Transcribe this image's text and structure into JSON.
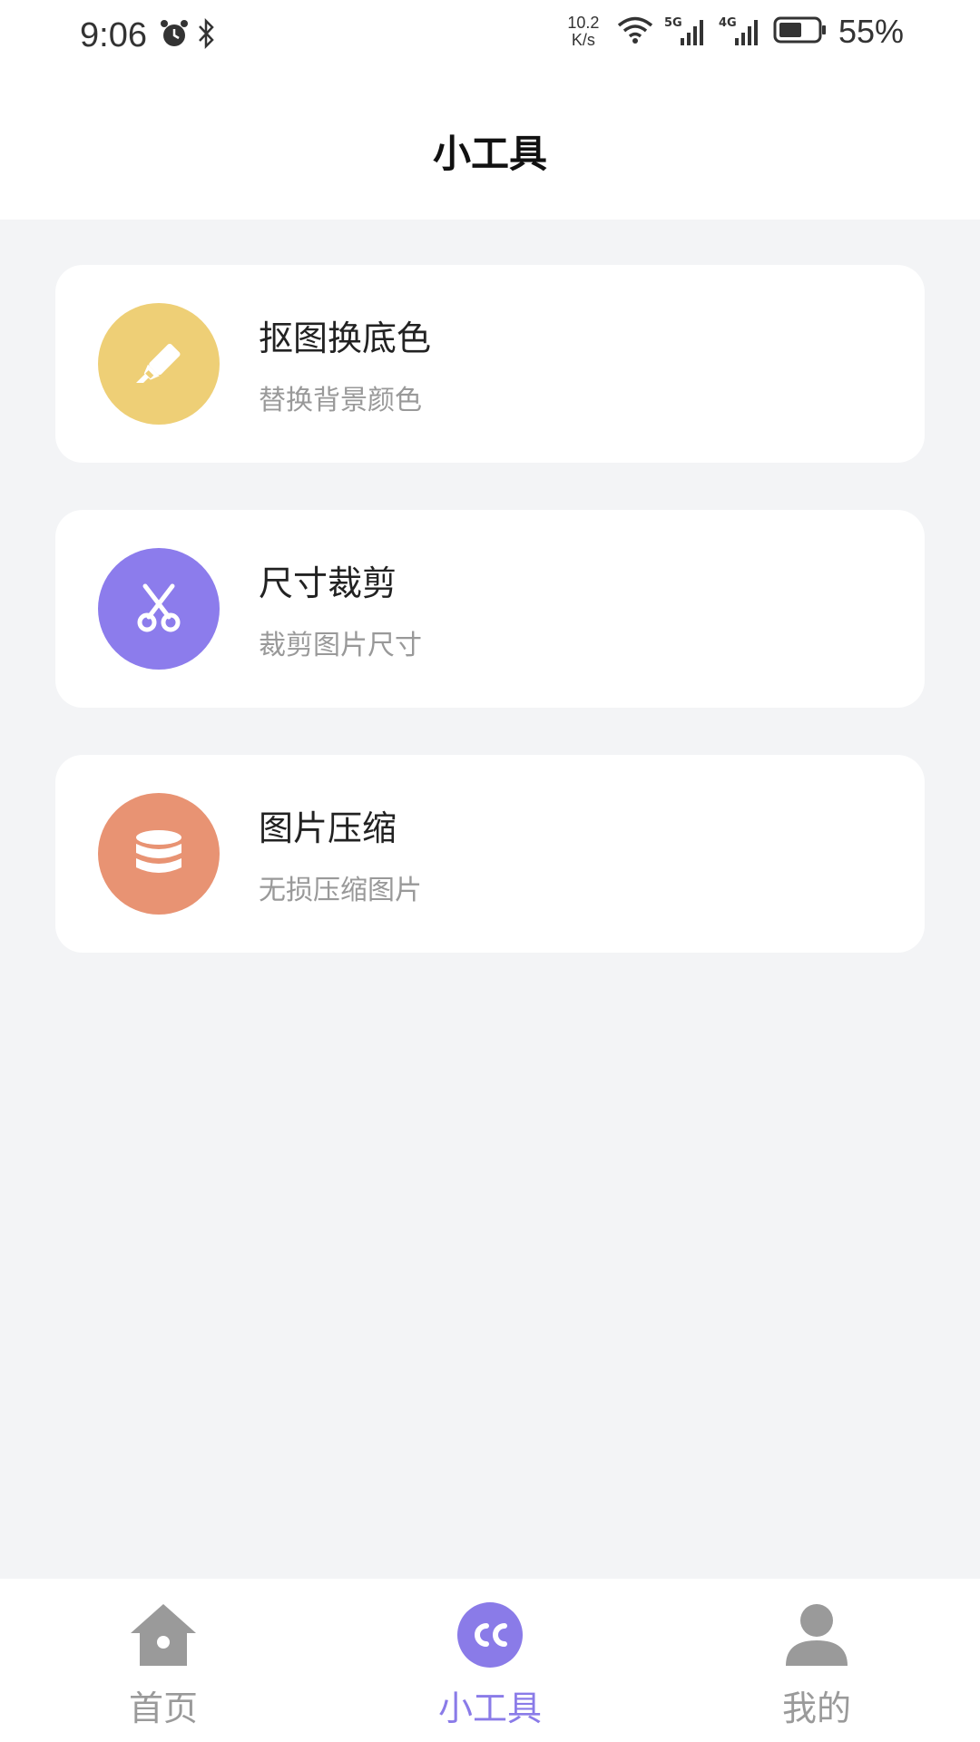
{
  "status_bar": {
    "time": "9:06",
    "net_speed_value": "10.2",
    "net_speed_unit": "K/s",
    "signal_1_label": "5G",
    "signal_2_label": "4G",
    "battery": "55%",
    "icons": [
      "alarm-icon",
      "bluetooth-icon",
      "wifi-icon",
      "signal-5g-icon",
      "signal-4g-icon",
      "battery-icon"
    ]
  },
  "header": {
    "title": "小工具"
  },
  "tools": [
    {
      "title": "抠图换底色",
      "subtitle": "替换背景颜色",
      "icon": "highlighter-icon",
      "color": "#eecf76"
    },
    {
      "title": "尺寸裁剪",
      "subtitle": "裁剪图片尺寸",
      "icon": "scissors-icon",
      "color": "#8c7cec"
    },
    {
      "title": "图片压缩",
      "subtitle": "无损压缩图片",
      "icon": "database-icon",
      "color": "#e89373"
    }
  ],
  "tabbar": {
    "tabs": [
      {
        "label": "首页",
        "icon": "home-icon",
        "active": false
      },
      {
        "label": "小工具",
        "icon": "cc-icon",
        "active": true
      },
      {
        "label": "我的",
        "icon": "user-icon",
        "active": false
      }
    ],
    "active_color": "#8a7be8",
    "inactive_color": "#9a9a9a"
  }
}
